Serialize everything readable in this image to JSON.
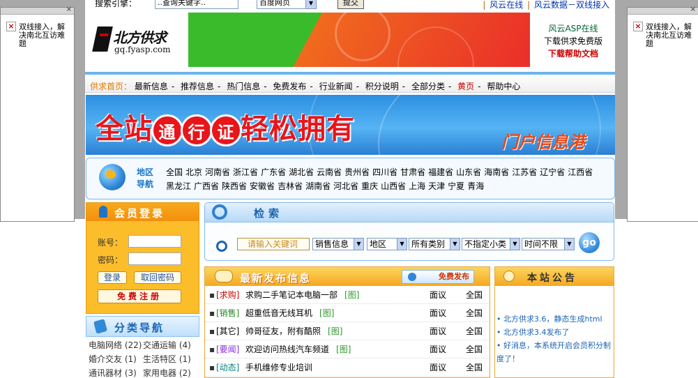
{
  "side_ads": {
    "left_text": "双线接入，解决南北互访难题",
    "right_text": "双线接入，解决南北互访难题",
    "close": "×",
    "broken_image_icon": "broken-image-icon"
  },
  "topbar": {
    "search_label": "搜索引擎：",
    "keyword_value": "..查询关键字..",
    "engine_value": "百度网页",
    "submit_label": "提交",
    "links": [
      "风云在线",
      "风云数据－双线接入"
    ]
  },
  "header": {
    "logo_name": "北方供求",
    "logo_domain": "gq.fyasp.com",
    "links": [
      "风云ASP在线",
      "下载供求免费版",
      "下载帮助文档"
    ]
  },
  "nav": {
    "home": "供求首页：",
    "items": [
      "最新信息",
      "推荐信息",
      "热门信息",
      "免费发布",
      "行业新闻",
      "积分说明",
      "全部分类",
      "黄页",
      "帮助中心"
    ],
    "separator": "-"
  },
  "banner": {
    "title_a": "全站",
    "circle1": "通",
    "circle2": "行",
    "circle3": "证",
    "title_b": "轻松拥有",
    "subtitle": "门户信息港"
  },
  "region": {
    "label": "地区导航",
    "items": [
      "全国",
      "北京",
      "河南省",
      "浙江省",
      "广东省",
      "湖北省",
      "云南省",
      "贵州省",
      "四川省",
      "甘肃省",
      "福建省",
      "山东省",
      "海南省",
      "江苏省",
      "辽宁省",
      "江西省",
      "黑龙江",
      "广西省",
      "陕西省",
      "安徽省",
      "吉林省",
      "湖南省",
      "河北省",
      "重庆",
      "山西省",
      "上海",
      "天津",
      "宁夏",
      "青海"
    ]
  },
  "login": {
    "title": "会员登录",
    "account_label": "账号：",
    "password_label": "密码：",
    "login_button": "登录",
    "recover_button": "取回密码",
    "register_button": "免费注册"
  },
  "categories": {
    "title": "分类导航",
    "items": [
      [
        "电脑网络 (22)",
        "交通运输 (4)"
      ],
      [
        "婚介交友 (1)",
        "生活特区 (1)"
      ],
      [
        "通讯器材 (3)",
        "家用电器 (2)"
      ]
    ]
  },
  "search": {
    "title": "检索",
    "keyword_placeholder": "请输入关键词",
    "selects": [
      "销售信息",
      "地区",
      "所有类别",
      "不指定小类",
      "时间不限"
    ],
    "go_label": "go"
  },
  "latest": {
    "title": "最新发布信息",
    "publish_button": "免费发布",
    "rows": [
      {
        "tag": "[求购]",
        "title": "求购二手笔记本电脑一部",
        "img": "[图]",
        "price": "面议",
        "area": "全国"
      },
      {
        "tag": "[销售]",
        "title": "超重低音无线耳机",
        "img": "[图]",
        "price": "面议",
        "area": "全国"
      },
      {
        "tag": "[其它]",
        "title": "帅哥征友，附有酷照",
        "img": "[图]",
        "price": "面议",
        "area": "全国"
      },
      {
        "tag": "[要闻]",
        "title": "欢迎访问热线汽车频道",
        "img": "[图]",
        "price": "面议",
        "area": "全国"
      },
      {
        "tag": "[动态]",
        "title": "手机维修专业培训",
        "img": "",
        "price": "面议",
        "area": "全国"
      }
    ]
  },
  "notice": {
    "title": "本站公告",
    "items": [
      "北方供求3.6，静态生成html",
      "北方供求3.4发布了",
      "好消息，本系统开启会员积分制度了！"
    ]
  },
  "colors": {
    "nav_accent": "#69b4ec",
    "brand_red": "#e8151b",
    "orange_panel": "#fbbd2a",
    "link_blue": "#1a64b4"
  }
}
